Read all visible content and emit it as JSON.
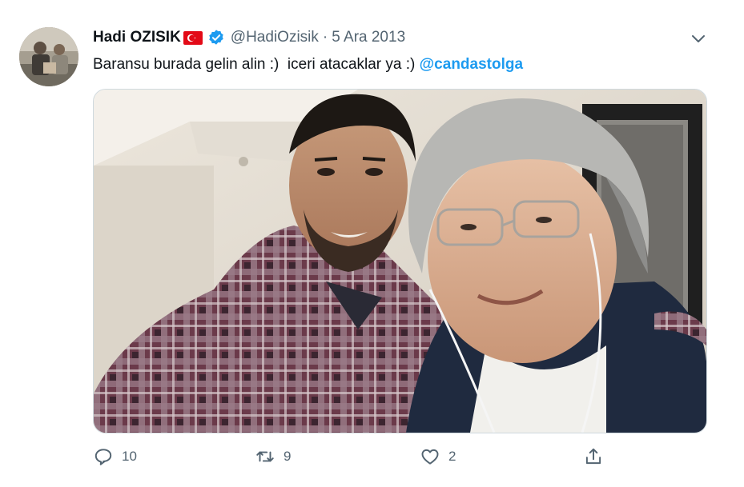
{
  "tweet": {
    "author_name": "Hadi OZISIK",
    "handle": "@HadiOzisik",
    "separator": "·",
    "date": "5 Ara 2013",
    "text": "Baransu burada gelin alin :)  iceri atacaklar ya :) ",
    "mention": "@candastolga"
  },
  "actions": {
    "reply_count": "10",
    "retweet_count": "9",
    "like_count": "2"
  },
  "icons": {
    "reply": "reply-icon",
    "retweet": "retweet-icon",
    "like": "heart-icon",
    "share": "share-icon",
    "more": "chevron-down-icon",
    "verified": "verified-badge-icon",
    "flag": "turkey-flag-icon"
  },
  "colors": {
    "link": "#1d9bf0",
    "secondary_text": "#536471",
    "verified": "#1d9bf0",
    "flag": "#e30a17"
  }
}
